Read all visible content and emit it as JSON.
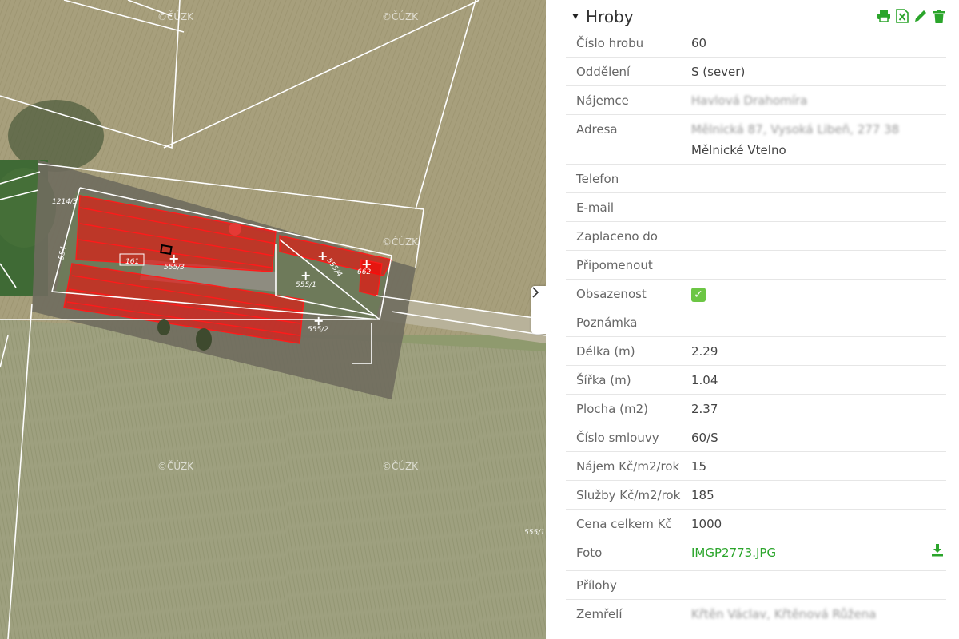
{
  "map": {
    "watermark": "©ČÚZK",
    "parcel_labels": [
      "1214/3",
      "161",
      "555/3",
      "555/1",
      "555/4",
      "555/2",
      "555/1",
      "554",
      "662"
    ]
  },
  "panel": {
    "title": "Hroby",
    "toggle_icon": "chevron-right-icon",
    "tools": [
      "print-icon",
      "excel-icon",
      "pencil-icon",
      "trash-icon"
    ],
    "accent_color": "#2ba52b",
    "rows": [
      {
        "label": "Číslo hrobu",
        "value": "60"
      },
      {
        "label": "Oddělení",
        "value": "S (sever)"
      },
      {
        "label": "Nájemce",
        "value": "Havlová Drahomíra",
        "obscured": true
      },
      {
        "label": "Adresa",
        "value": "Mělnická 87, Vysoká Libeň, 277 38",
        "value2": "Mělnické Vtelno",
        "obscured": true
      },
      {
        "label": "Telefon",
        "value": ""
      },
      {
        "label": "E-mail",
        "value": ""
      },
      {
        "label": "Zaplaceno do",
        "value": ""
      },
      {
        "label": "Připomenout",
        "value": ""
      },
      {
        "label": "Obsazenost",
        "value": "✓"
      },
      {
        "label": "Poznámka",
        "value": ""
      },
      {
        "label": "Délka (m)",
        "value": "2.29"
      },
      {
        "label": "Šířka (m)",
        "value": "1.04"
      },
      {
        "label": "Plocha (m2)",
        "value": "2.37"
      },
      {
        "label": "Číslo smlouvy",
        "value": "60/S"
      },
      {
        "label": "Nájem Kč/m2/rok",
        "value": "15"
      },
      {
        "label": "Služby Kč/m2/rok",
        "value": "185"
      },
      {
        "label": "Cena celkem Kč",
        "value": "1000"
      },
      {
        "label": "Foto",
        "value": "IMGP2773.JPG"
      },
      {
        "label": "Přílohy",
        "value": ""
      },
      {
        "label": "Zemřelí",
        "value": "Křtěn Václav, Křtěnová Růžena",
        "obscured": true
      }
    ]
  }
}
